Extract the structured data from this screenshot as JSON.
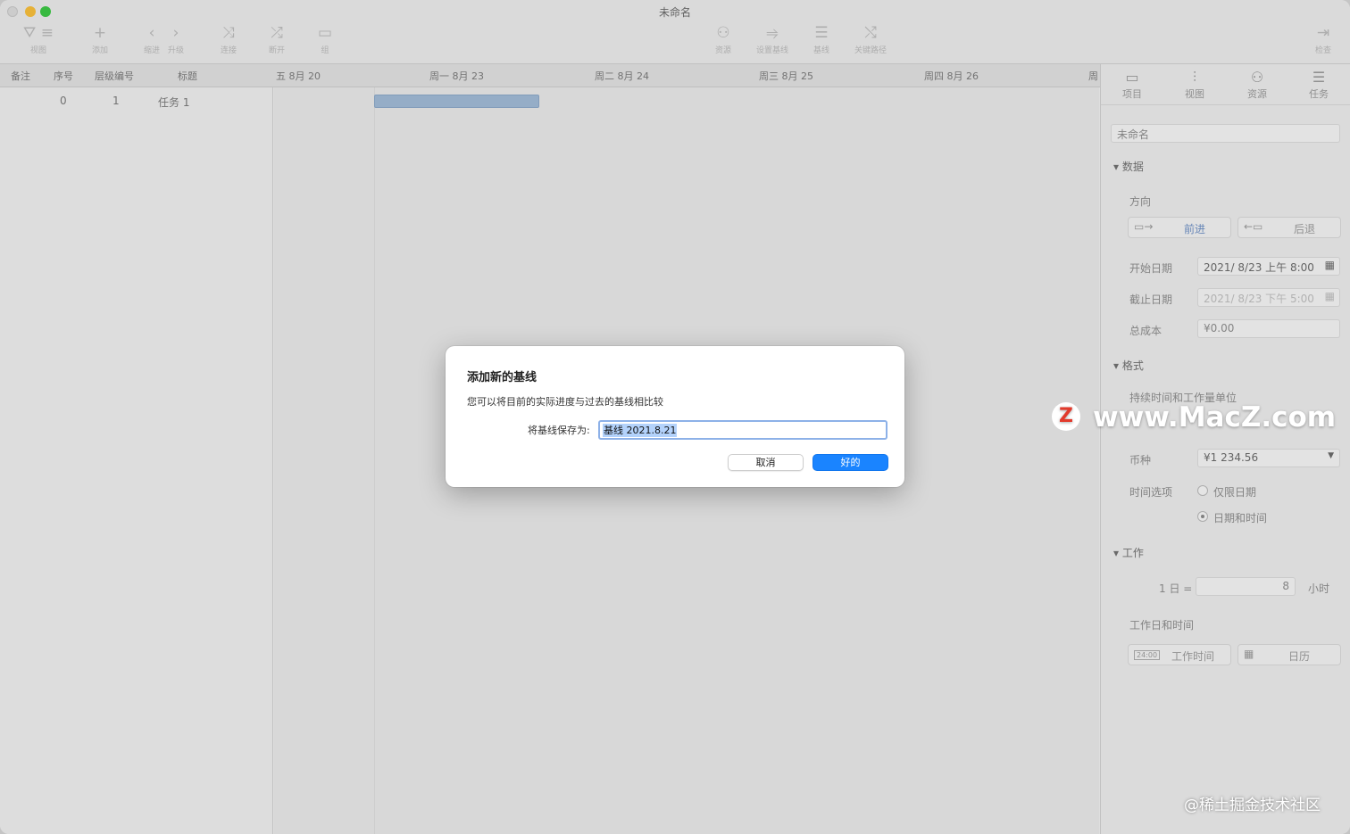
{
  "window": {
    "title": "未命名"
  },
  "toolbar": {
    "items": [
      {
        "label": "视图",
        "icon": "view-icon"
      },
      {
        "label": "添加",
        "icon": "add-icon"
      },
      {
        "label": "缩进",
        "icon": "outdent-icon"
      },
      {
        "label": "升级",
        "icon": "indent-icon"
      },
      {
        "label": "连接",
        "icon": "connect-icon"
      },
      {
        "label": "断开",
        "icon": "disconnect-icon"
      },
      {
        "label": "组",
        "icon": "group-icon"
      },
      {
        "label": "资源",
        "icon": "resource-icon"
      },
      {
        "label": "设置基线",
        "icon": "set-baseline-icon"
      },
      {
        "label": "基线",
        "icon": "baseline-icon"
      },
      {
        "label": "关键路径",
        "icon": "critical-path-icon"
      },
      {
        "label": "检查",
        "icon": "inspector-icon"
      }
    ]
  },
  "columns": [
    "备注",
    "序号",
    "层级编号",
    "标题"
  ],
  "timeline": [
    "五 8月 20",
    "周一 8月 23",
    "周二 8月 24",
    "周三 8月 25",
    "周四 8月 26",
    "周"
  ],
  "rows": [
    {
      "index": "0",
      "level": "1",
      "title": "任务 1"
    }
  ],
  "inspector": {
    "tabs": [
      {
        "label": "项目",
        "icon": "project-icon"
      },
      {
        "label": "视图",
        "icon": "sliders-icon"
      },
      {
        "label": "资源",
        "icon": "people-icon"
      },
      {
        "label": "任务",
        "icon": "task-icon"
      }
    ],
    "project_name": "未命名",
    "section_data": "数据",
    "direction_label": "方向",
    "forward": "前进",
    "backward": "后退",
    "start_label": "开始日期",
    "start_value": "2021/ 8/23 上午 8:00",
    "end_label": "截止日期",
    "end_value": "2021/ 8/23 下午 5:00",
    "cost_label": "总成本",
    "cost_value": "¥0.00",
    "section_format": "格式",
    "duration_label": "持续时间和工作量单位",
    "currency_label": "币种",
    "currency_value": "¥1 234.56",
    "time_options_label": "时间选项",
    "date_only": "仅限日期",
    "date_time": "日期和时间",
    "section_work": "工作",
    "day_eq": "1 日 =",
    "day_hours": "8",
    "hours_unit": "小时",
    "workdays_label": "工作日和时间",
    "work_time": "工作时间",
    "calendar": "日历",
    "work_time_icon_text": "24:00"
  },
  "dialog": {
    "title": "添加新的基线",
    "message": "您可以将目前的实际进度与过去的基线相比较",
    "save_as_label": "将基线保存为:",
    "input_value": "基线 2021.8.21",
    "cancel": "取消",
    "ok": "好的"
  },
  "watermark": {
    "logo": "Z",
    "text": "www.MacZ.com",
    "credit": "@稀土掘金技术社区"
  },
  "colors": {
    "accent": "#1a84ff",
    "task_bar": "#9fb8d4",
    "selection": "#b3d2fb"
  }
}
